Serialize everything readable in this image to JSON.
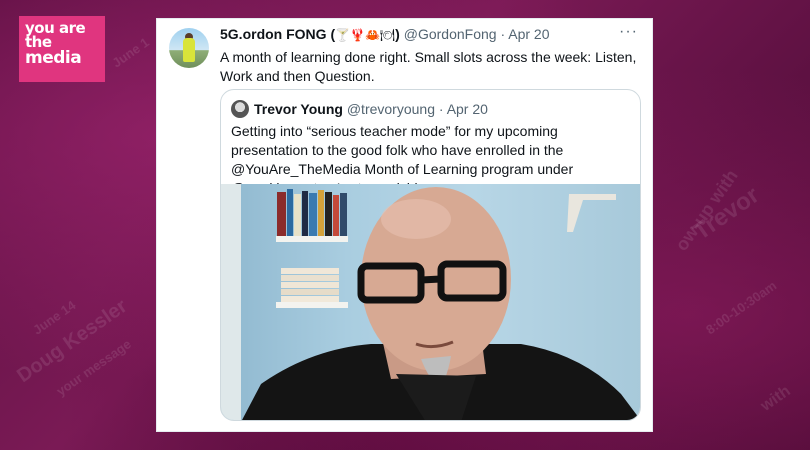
{
  "background": {
    "fragments": [
      "Doug Kessler",
      "Trevor",
      "ow-up with",
      "June 1",
      "June 14",
      "8:00-10:30am",
      "your message",
      "with"
    ]
  },
  "logo": {
    "line1": "you are the",
    "line2": "media"
  },
  "tweet": {
    "author_name": "5G.ordon FONG (",
    "author_emoji": "🍸🦞🦀🍽",
    "author_close": ")",
    "handle": "@GordonFong",
    "separator": "·",
    "date": "Apr 20",
    "more": "···",
    "text": "A month of learning done right. Small slots across the week: Listen, Work and then Question.",
    "quoted": {
      "author_name": "Trevor Young",
      "handle": "@trevoryoung",
      "separator": "·",
      "date": "Apr 20",
      "text": "Getting into “serious teacher mode” for my upcoming presentation to the good folk who have enrolled in the @YouAre_TheMedia Month of Learning program under @markiemasters’s stewardship."
    }
  },
  "colors": {
    "brand_pink": "#e0357f",
    "background": "#6b1550",
    "link": "#1d9bf0"
  }
}
